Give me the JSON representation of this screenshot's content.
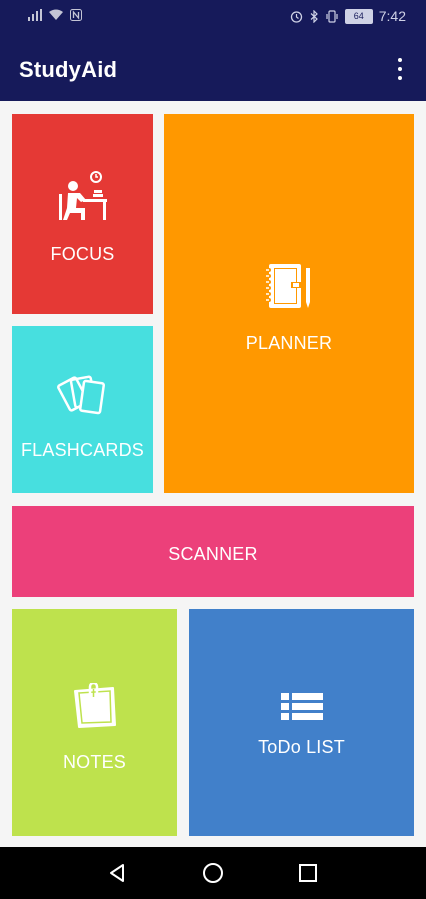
{
  "status_bar": {
    "time": "7:42",
    "battery": "64",
    "icons": [
      "signal-icon",
      "wifi-icon",
      "nfc-icon",
      "alarm-icon",
      "bluetooth-icon",
      "vibrate-icon",
      "battery-icon"
    ]
  },
  "app_bar": {
    "title": "StudyAid",
    "menu_icon": "more-vert-icon"
  },
  "tiles": {
    "focus": {
      "label": "FOCUS",
      "icon": "desk-study-icon",
      "color": "#e53935"
    },
    "planner": {
      "label": "PLANNER",
      "icon": "planner-notebook-icon",
      "color": "#ff9800"
    },
    "flashcards": {
      "label": "FLASHCARDS",
      "icon": "flashcards-icon",
      "color": "#47dfdf"
    },
    "scanner": {
      "label": "SCANNER",
      "color": "#ec407a"
    },
    "notes": {
      "label": "NOTES",
      "icon": "sticky-note-icon",
      "color": "#bee24d"
    },
    "todo": {
      "label": "ToDo LIST",
      "icon": "list-icon",
      "color": "#4180ca"
    }
  },
  "nav_bar": {
    "back_icon": "back-triangle-icon",
    "home_icon": "home-circle-icon",
    "recents_icon": "recents-square-icon"
  },
  "colors": {
    "app_bar": "#161a5a",
    "background": "#f5f5f5"
  }
}
